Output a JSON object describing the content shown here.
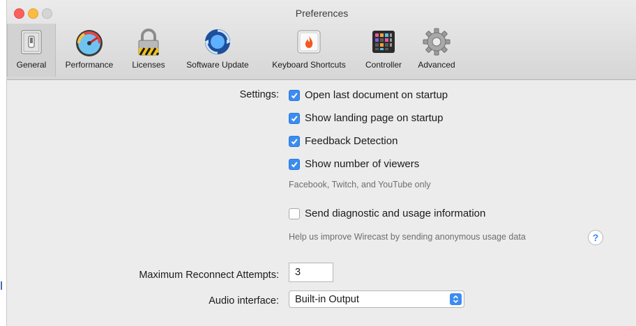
{
  "window": {
    "title": "Preferences"
  },
  "toolbar": {
    "items": [
      {
        "label": "General",
        "icon": "switch-icon",
        "selected": true
      },
      {
        "label": "Performance",
        "icon": "gauge-icon"
      },
      {
        "label": "Licenses",
        "icon": "padlock-icon"
      },
      {
        "label": "Software Update",
        "icon": "refresh-icon"
      },
      {
        "label": "Keyboard Shortcuts",
        "icon": "flame-icon"
      },
      {
        "label": "Controller",
        "icon": "launchpad-icon"
      },
      {
        "label": "Advanced",
        "icon": "gear-icon"
      }
    ]
  },
  "settings": {
    "label": "Settings:",
    "checkboxes": [
      {
        "label": "Open last document on startup",
        "checked": true
      },
      {
        "label": "Show landing page on startup",
        "checked": true
      },
      {
        "label": "Feedback Detection",
        "checked": true
      },
      {
        "label": "Show number of viewers",
        "checked": true
      }
    ],
    "viewers_hint": "Facebook, Twitch, and YouTube only",
    "diagnostic": {
      "label": "Send diagnostic and usage information",
      "checked": false
    },
    "diagnostic_hint": "Help us improve Wirecast by sending anonymous usage data",
    "help_symbol": "?"
  },
  "reconnect": {
    "label": "Maximum Reconnect Attempts:",
    "value": "3"
  },
  "audio": {
    "label": "Audio interface:",
    "value": "Built-in Output"
  },
  "colors": {
    "accent": "#3b8cf0",
    "close": "#fc605c",
    "minimize": "#fdbc40"
  }
}
